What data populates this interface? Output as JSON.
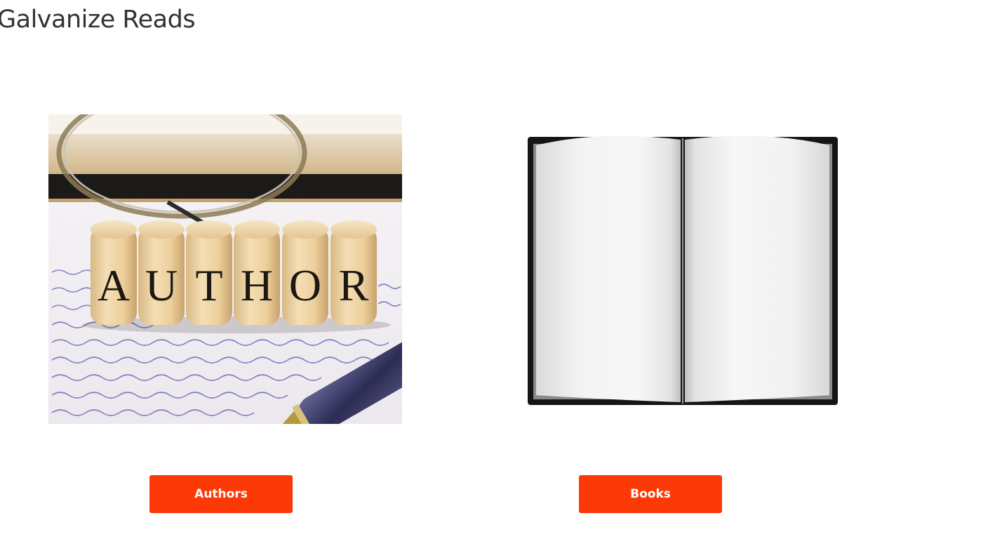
{
  "page": {
    "title": "Galvanize Reads"
  },
  "cards": [
    {
      "image_subject": "author letter blocks photo",
      "image_letters": [
        "A",
        "U",
        "T",
        "H",
        "O",
        "R"
      ],
      "button_label": "Authors"
    },
    {
      "image_subject": "open book icon",
      "button_label": "Books"
    }
  ],
  "colors": {
    "button_bg": "#fb3a07",
    "button_text": "#ffffff",
    "title_text": "#333333"
  }
}
